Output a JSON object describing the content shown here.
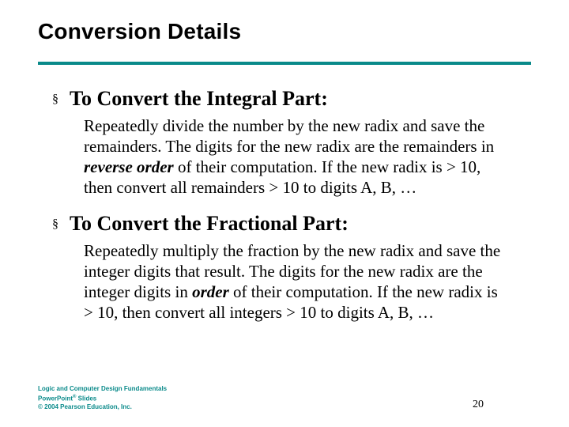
{
  "title": "Conversion Details",
  "bullets": [
    {
      "heading": "To Convert the Integral Part:",
      "body_pre": "Repeatedly divide the number by the new radix and save the remainders. The digits for the new radix are the remainders in ",
      "body_em": "reverse order",
      "body_post": " of their computation. If the new radix is > 10, then convert all remainders > 10 to digits A, B, …"
    },
    {
      "heading": "To Convert the Fractional Part:",
      "body_pre": "Repeatedly multiply the fraction by the new radix and save the integer digits that result.  The digits for the new radix are the integer digits in ",
      "body_em": "order",
      "body_post": " of their computation. If the new radix is > 10, then convert all integers > 10 to digits A, B, …"
    }
  ],
  "footer": {
    "line1": "Logic and Computer Design Fundamentals",
    "line2a": "PowerPoint",
    "line2b": " Slides",
    "line3": "© 2004 Pearson Education, Inc."
  },
  "page_number": "20",
  "bullet_marker": "§"
}
